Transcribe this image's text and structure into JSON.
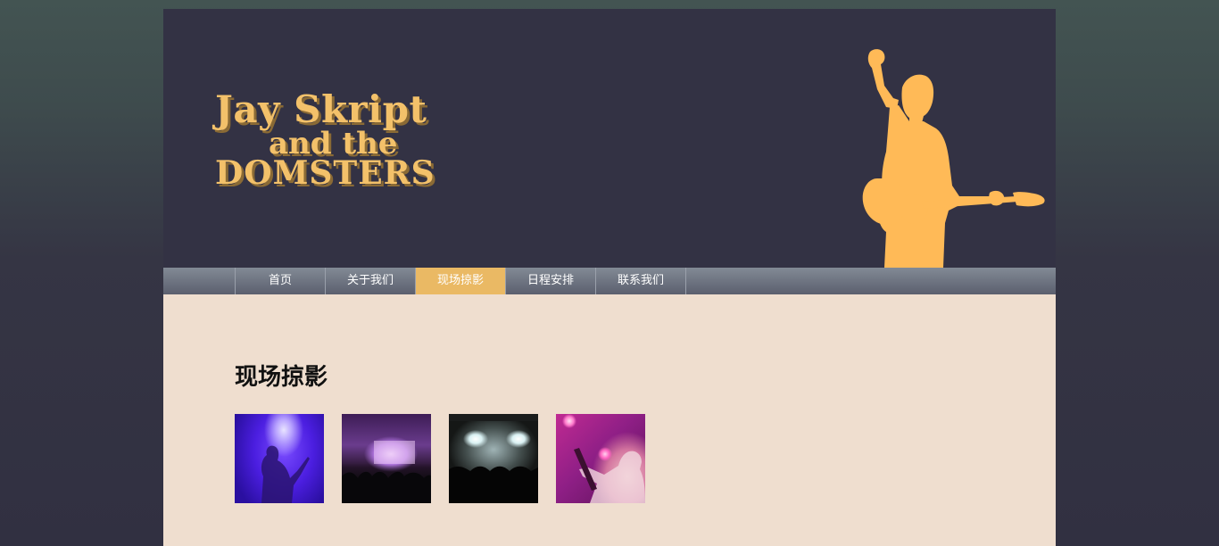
{
  "header": {
    "logo_line1": "Jay Skript",
    "logo_line2": "and the",
    "logo_line3": "DOMSTERS",
    "silhouette_icon": "guitarist-silhouette-icon",
    "accent_color": "#f3c16a",
    "background_color": "#333244"
  },
  "nav": {
    "items": [
      {
        "label": "首页"
      },
      {
        "label": "关于我们"
      },
      {
        "label": "现场掠影",
        "active": true
      },
      {
        "label": "日程安排"
      },
      {
        "label": "联系我们"
      }
    ],
    "active_color": "#eab964"
  },
  "main": {
    "title": "现场掠影",
    "gallery": [
      {
        "name": "concert-photo-1",
        "alt": "guitarist under purple stage light"
      },
      {
        "name": "concert-photo-2",
        "alt": "crowd in front of stage screen"
      },
      {
        "name": "concert-photo-3",
        "alt": "stage lights over crowd"
      },
      {
        "name": "concert-photo-4",
        "alt": "guitarist under pink lights"
      }
    ],
    "background_color": "#efdecf"
  }
}
